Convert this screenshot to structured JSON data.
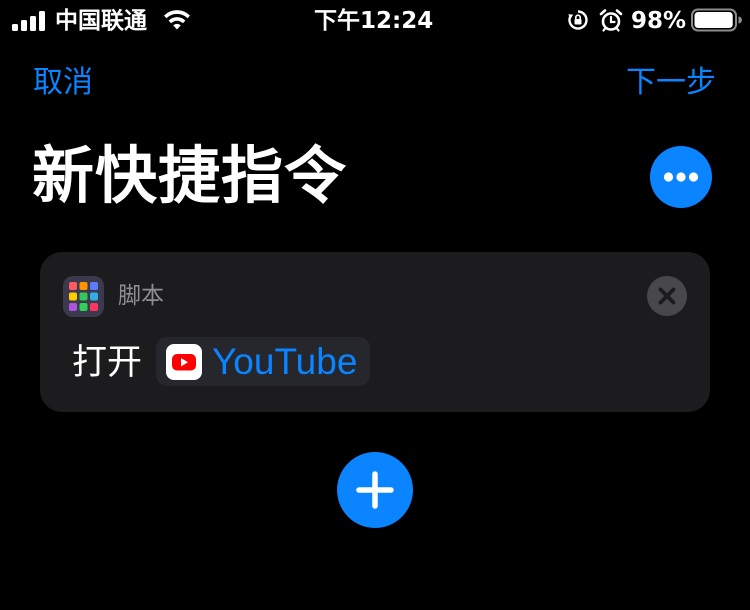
{
  "status_bar": {
    "carrier": "中国联通",
    "time": "下午12:24",
    "battery_percent": "98%",
    "battery_level": 0.98,
    "icons": [
      "signal-icon",
      "wifi-icon",
      "orientation-lock-icon",
      "alarm-icon",
      "battery-icon"
    ]
  },
  "nav": {
    "cancel_label": "取消",
    "next_label": "下一步"
  },
  "title": "新快捷指令",
  "more_icon": "ellipsis-icon",
  "action": {
    "category": "脚本",
    "category_icon": "scripting-grid-icon",
    "verb": "打开",
    "app_name": "YouTube",
    "app_icon": "youtube-icon",
    "remove_icon": "close-icon"
  },
  "add_icon": "plus-icon",
  "colors": {
    "accent": "#0a84ff",
    "background": "#000000",
    "card": "#1c1c1e",
    "secondary_text": "#8e8e93",
    "youtube_red": "#ff0000"
  }
}
